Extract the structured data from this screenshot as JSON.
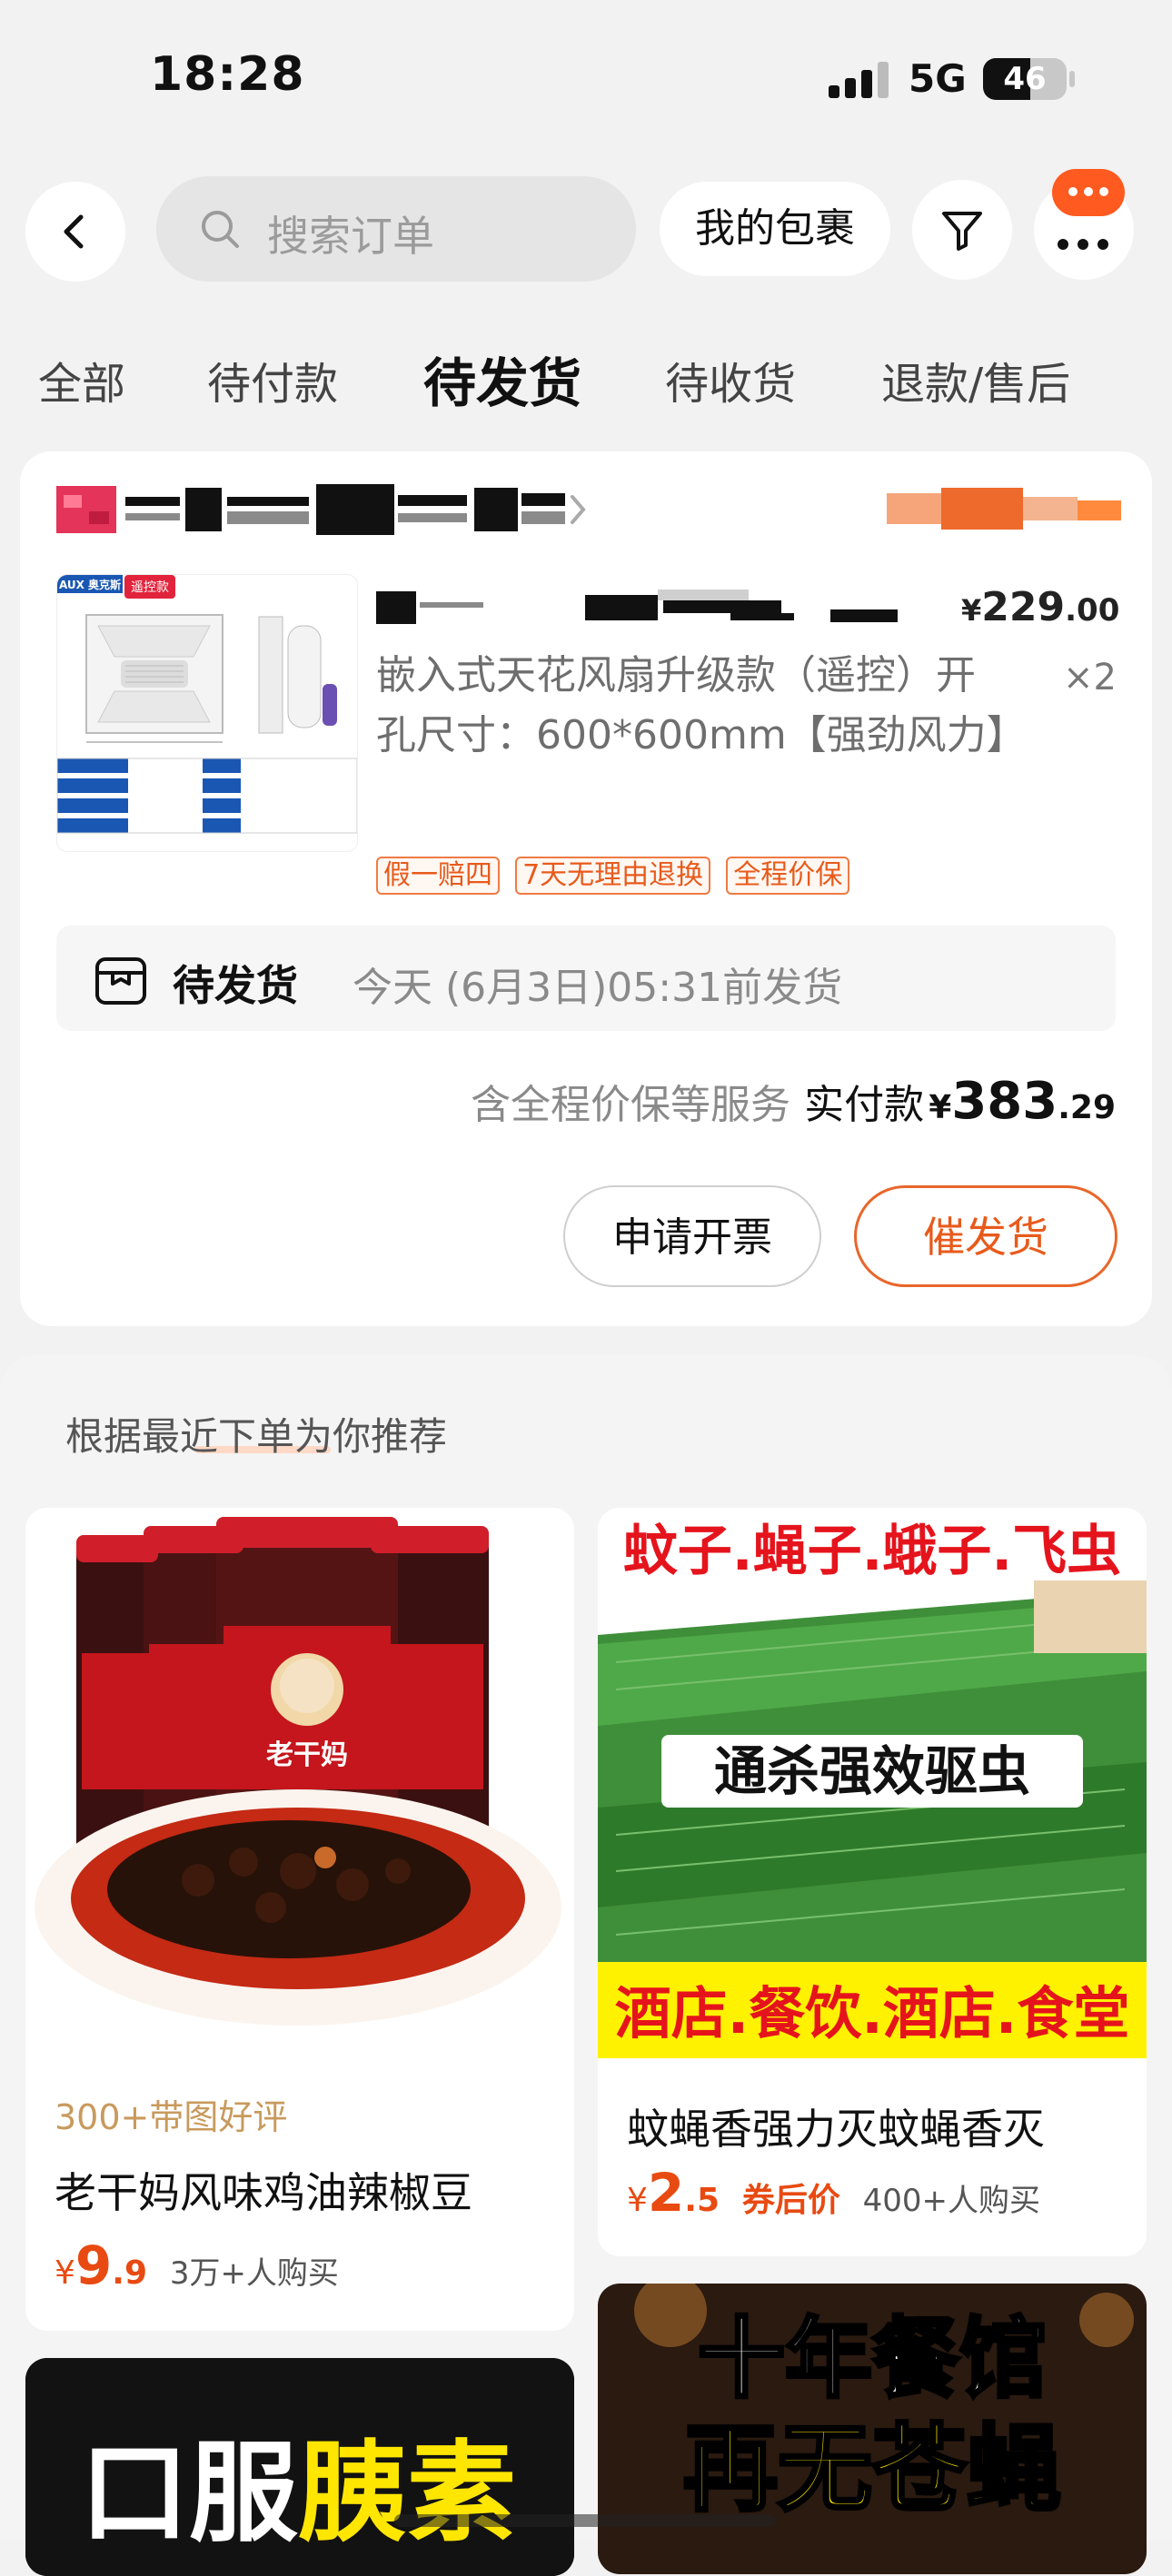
{
  "status_bar": {
    "time": "18:28",
    "network": "5G",
    "battery": "46",
    "battery_level_percent": 46
  },
  "topbar": {
    "search_placeholder": "搜索订单",
    "packages_label": "我的包裹",
    "icons": [
      "back-arrow-icon",
      "search-icon",
      "filter-icon",
      "more-icon",
      "message-icon"
    ]
  },
  "tabs": [
    {
      "label": "全部",
      "active": false
    },
    {
      "label": "待付款",
      "active": false
    },
    {
      "label": "待发货",
      "active": true
    },
    {
      "label": "待收货",
      "active": false
    },
    {
      "label": "退款/售后",
      "active": false
    }
  ],
  "order": {
    "product": {
      "price_symbol": "¥",
      "price_int": "229",
      "price_dec": ".00",
      "quantity": "×2",
      "description": "嵌入式天花风扇升级款（遥控）开孔尺寸：600*600mm【强劲风力】",
      "image_brand": "AUX 奥克斯",
      "image_badge": "遥控款",
      "tags": [
        "假一赔四",
        "7天无理由退换",
        "全程价保"
      ]
    },
    "shipping": {
      "status": "待发货",
      "time": "今天 (6月3日)05:31前发货"
    },
    "total": {
      "service_note": "含全程价保等服务",
      "label": "实付款",
      "symbol": "¥",
      "int": "383",
      "dec": ".29"
    },
    "buttons": {
      "invoice": "申请开票",
      "urge": "催发货"
    }
  },
  "recommend": {
    "title": "根据最近下单为你推荐",
    "items": [
      {
        "review": "300+带图好评",
        "title": "老干妈风味鸡油辣椒豆",
        "price_symbol": "¥",
        "price_int": "9",
        "price_dec": ".9",
        "sales": "3万+人购买",
        "image_label": "老干妈"
      },
      {
        "title": "蚊蝇香强力灭蚊蝇香灭",
        "price_symbol": "¥",
        "price_int": "2",
        "price_dec": ".5",
        "coupon": "券后价",
        "sales": "400+人购买",
        "image_texts": [
          "蚊子.蝇子.蛾子.飞虫",
          "通杀强效驱虫",
          "酒店.餐饮.酒店.食堂"
        ]
      },
      {
        "image_texts": [
          "口服",
          "胰素"
        ]
      },
      {
        "image_texts": [
          "十年餐馆",
          "再无苍蝇"
        ]
      }
    ]
  },
  "colors": {
    "accent": "#e85a1b",
    "background": "#f2f2f2",
    "card": "#ffffff"
  }
}
